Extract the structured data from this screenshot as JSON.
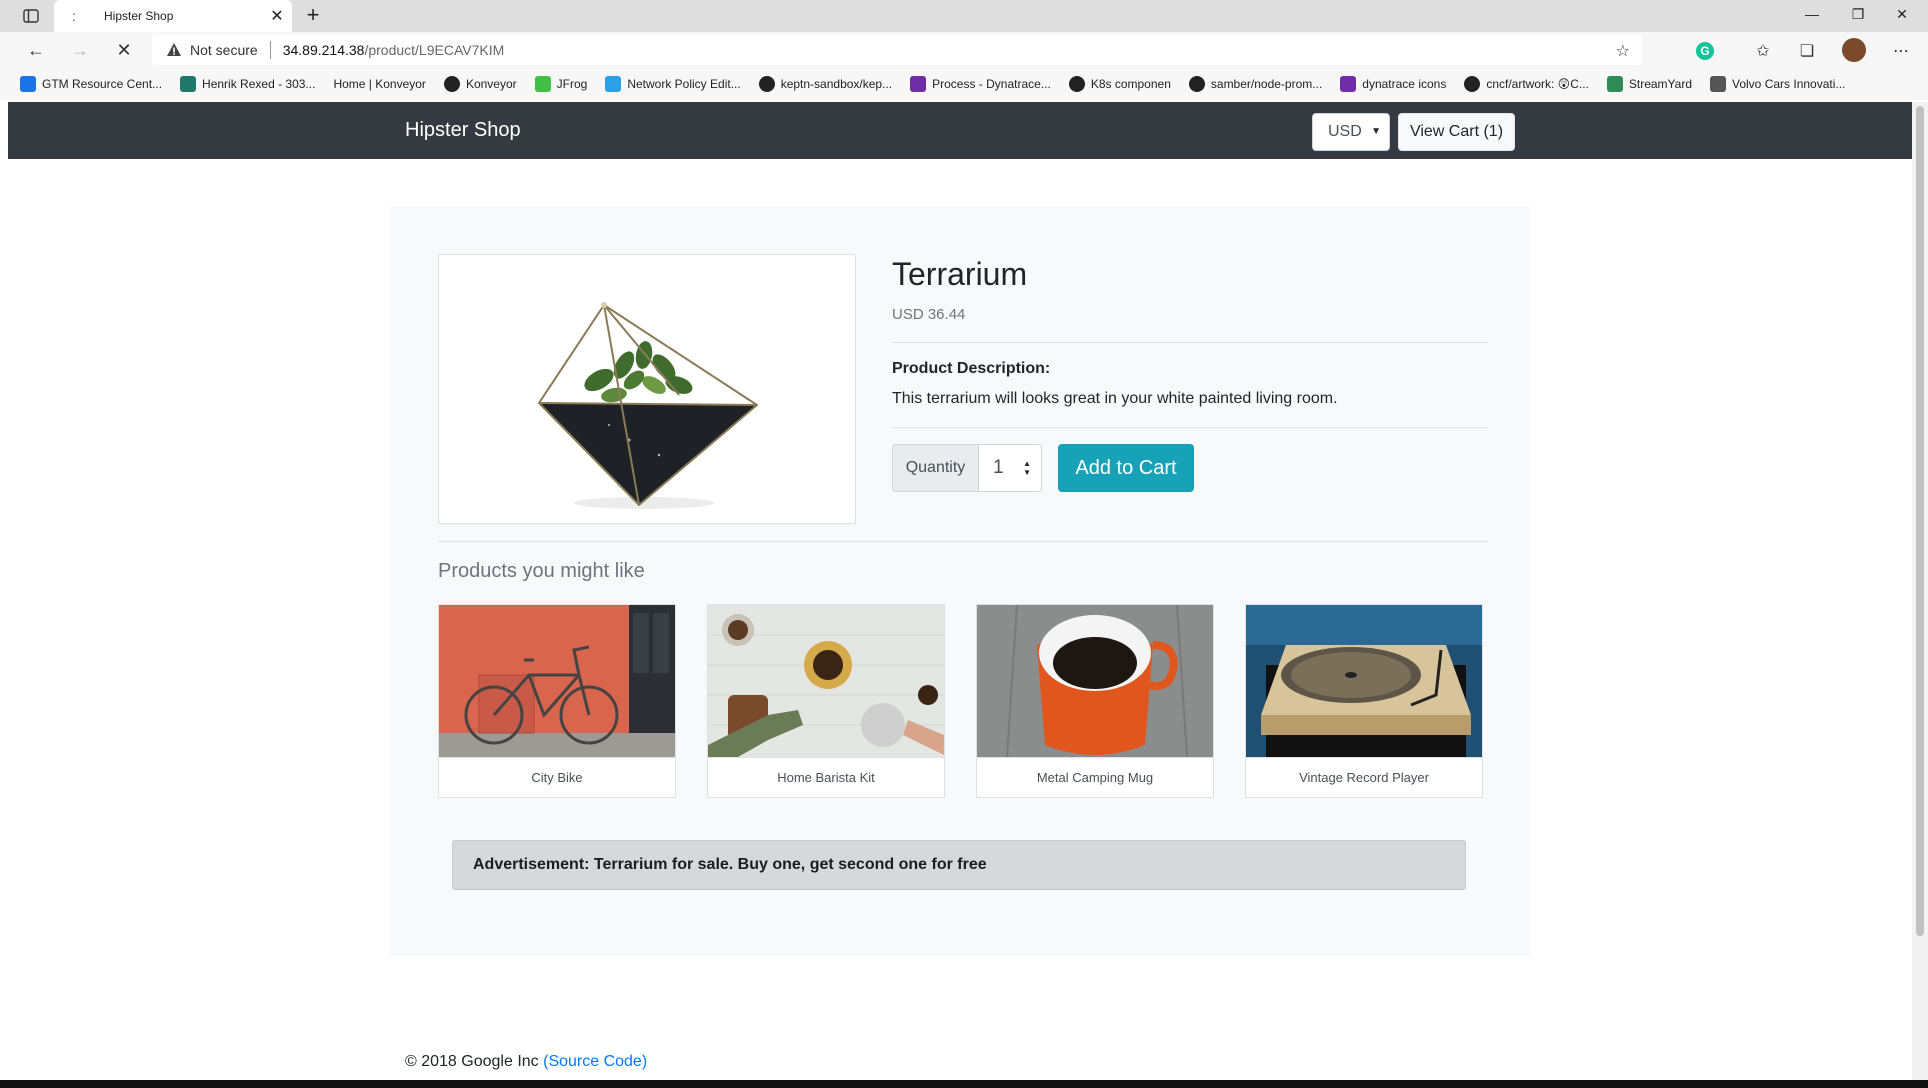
{
  "browser": {
    "tab_title": "Hipster Shop",
    "tab_favicon": ":",
    "new_tab": "+",
    "not_secure": "Not secure",
    "url_host": "34.89.214.38",
    "url_path": "/product/L9ECAV7KIM",
    "bookmarks": [
      {
        "label": "GTM Resource Cent...",
        "icon": "gtm-icon",
        "color": "#1a73e8"
      },
      {
        "label": "Henrik Rexed - 303...",
        "icon": "bookmark-icon",
        "color": "#1f7a6b"
      },
      {
        "label": "Home | Konveyor",
        "icon": "",
        "color": ""
      },
      {
        "label": "Konveyor",
        "icon": "github-icon",
        "color": "#222222"
      },
      {
        "label": "JFrog",
        "icon": "jfrog-icon",
        "color": "#41bf47"
      },
      {
        "label": "Network Policy Edit...",
        "icon": "cilium-icon",
        "color": "#2aa0e6"
      },
      {
        "label": "keptn-sandbox/kep...",
        "icon": "github-icon",
        "color": "#222222"
      },
      {
        "label": "Process - Dynatrace...",
        "icon": "dynatrace-icon",
        "color": "#6f2da8"
      },
      {
        "label": "K8s componen",
        "icon": "github-icon",
        "color": "#222222"
      },
      {
        "label": "samber/node-prom...",
        "icon": "github-icon",
        "color": "#222222"
      },
      {
        "label": "dynatrace icons",
        "icon": "dynatrace-icon",
        "color": "#6f2da8"
      },
      {
        "label": "cncf/artwork: 😲C...",
        "icon": "github-icon",
        "color": "#222222"
      },
      {
        "label": "StreamYard",
        "icon": "streamyard-icon",
        "color": "#2e8b57"
      },
      {
        "label": "Volvo Cars Innovati...",
        "icon": "volvo-icon",
        "color": "#555555"
      }
    ]
  },
  "shop": {
    "brand": "Hipster Shop",
    "currency": "USD",
    "view_cart": "View Cart (1)"
  },
  "product": {
    "title": "Terrarium",
    "price": "USD 36.44",
    "description_label": "Product Description:",
    "description": "This terrarium will looks great in your white painted living room.",
    "quantity_label": "Quantity",
    "quantity_value": "1",
    "add_to_cart": "Add to Cart"
  },
  "recommendations": {
    "title": "Products you might like",
    "items": [
      {
        "name": "City Bike"
      },
      {
        "name": "Home Barista Kit"
      },
      {
        "name": "Metal Camping Mug"
      },
      {
        "name": "Vintage Record Player"
      }
    ]
  },
  "ad": {
    "text": "Advertisement: Terrarium for sale. Buy one, get second one for free"
  },
  "footer": {
    "copyright": "© 2018 Google Inc",
    "source_link": "(Source Code)"
  },
  "colors": {
    "navbar": "#343a40",
    "add_to_cart": "#17a2b8",
    "link": "#007bff",
    "ad_background": "#d6d8db"
  }
}
